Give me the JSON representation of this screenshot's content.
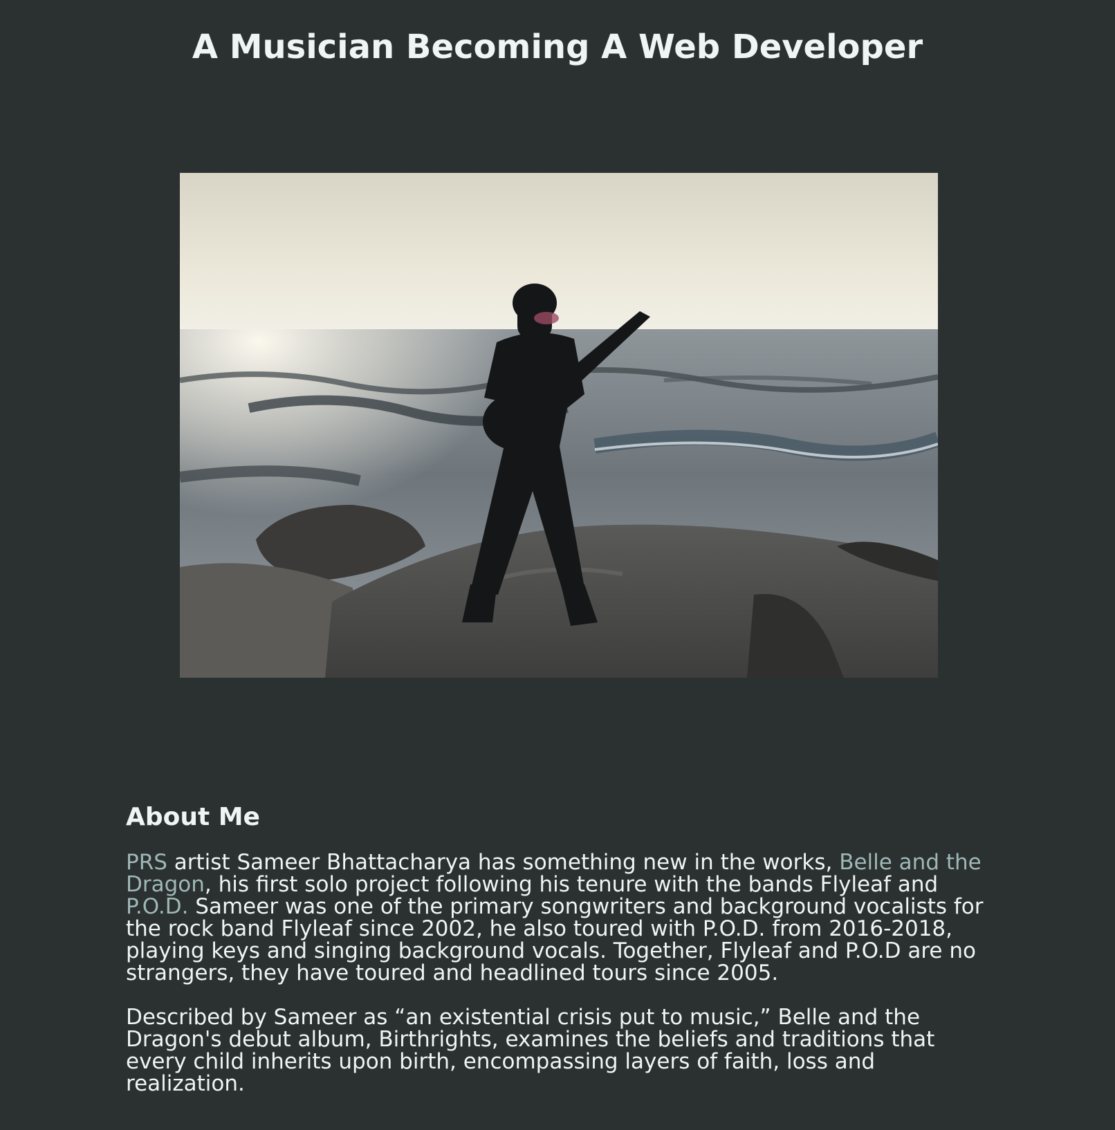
{
  "header": {
    "title": "A Musician Becoming A Web Developer"
  },
  "hero": {
    "alt": "Sameer Bhattacharya playing guitar on rocks by the ocean"
  },
  "about": {
    "heading": "About Me",
    "p1": {
      "link_prs": "PRS",
      "t1": " artist Sameer Bhattacharya has something new in the works, ",
      "link_belle": "Belle and the Dragon",
      "t2": ", his first solo project following his tenure with the bands Flyleaf and ",
      "link_pod": "P.O.D.",
      "t3": " Sameer was one of the primary songwriters and background vocalists for the rock band Flyleaf since 2002, he also toured with P.O.D. from 2016-2018, playing keys and singing background vocals. Together, Flyleaf and P.O.D are no strangers, they have toured and headlined tours since 2005."
    },
    "p2": "Described by Sameer as “an existential crisis put to music,” Belle and the Dragon's debut album, Birthrights, examines the beliefs and traditions that every child inherits upon birth, encompassing layers of faith, loss and realization."
  },
  "colors": {
    "background": "#2b3031",
    "text": "#eef5f3",
    "link": "#9fb8b6"
  }
}
